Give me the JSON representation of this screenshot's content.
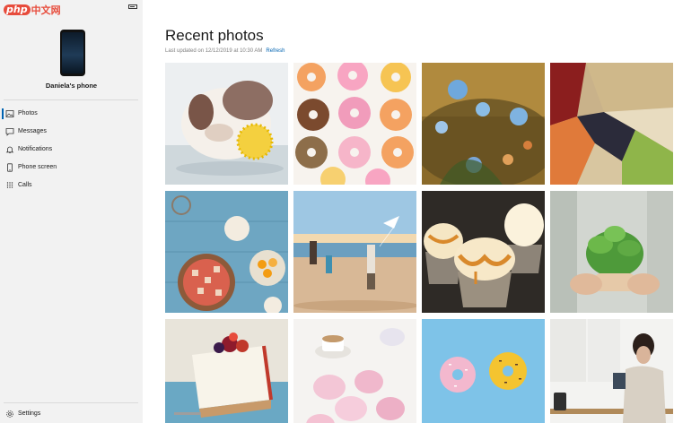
{
  "brand": {
    "php": "php",
    "cn": "中文网"
  },
  "device": {
    "name": "Daniela's phone"
  },
  "nav": {
    "photos": "Photos",
    "messages": "Messages",
    "notifications": "Notifications",
    "phone_screen": "Phone screen",
    "calls": "Calls",
    "settings": "Settings",
    "active": "photos"
  },
  "main": {
    "title": "Recent photos",
    "last_updated": "Last updated on 12/12/2019 at 10:30 AM",
    "refresh": "Refresh"
  },
  "photos": [
    {
      "subject": "bulldog-with-yellow-ball"
    },
    {
      "subject": "glazed-donuts"
    },
    {
      "subject": "blue-flowers"
    },
    {
      "subject": "beans-and-lentils"
    },
    {
      "subject": "cooking-table-top-view"
    },
    {
      "subject": "family-with-kite-on-beach"
    },
    {
      "subject": "caramel-cupcakes"
    },
    {
      "subject": "hands-holding-basil-plant"
    },
    {
      "subject": "berry-cheesecake"
    },
    {
      "subject": "pink-meringues-and-coffee"
    },
    {
      "subject": "two-donuts-on-blue"
    },
    {
      "subject": "woman-reading-in-kitchen"
    }
  ],
  "colors": {
    "accent": "#0063b1",
    "sidebar_bg": "#f2f2f2"
  }
}
